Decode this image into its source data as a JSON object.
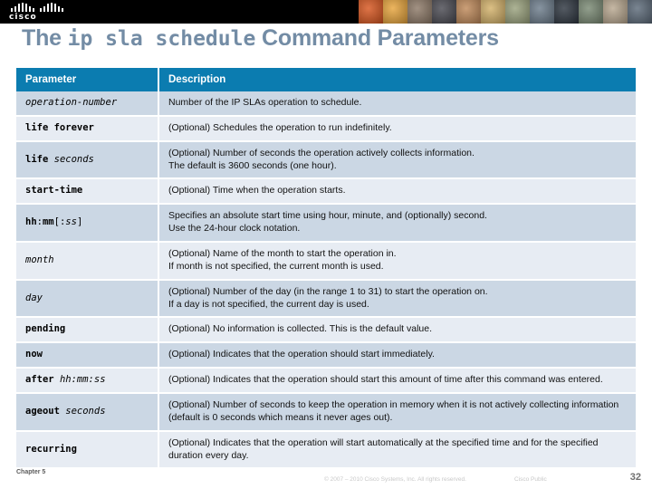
{
  "banner": {
    "logo_text": "cisco",
    "logo_name": "cisco-logo",
    "photo_strip_name": "people-photo-montage"
  },
  "slide": {
    "title_prefix": "The ",
    "title_command": "ip sla schedule",
    "title_suffix": " Command Parameters"
  },
  "table": {
    "headers": [
      "Parameter",
      "Description"
    ],
    "rows": [
      {
        "param_html": "<i>operation-number</i>",
        "param_text": "operation-number",
        "description": "Number of the IP SLAs operation to schedule."
      },
      {
        "param_html": "<b>life forever</b>",
        "param_text": "life forever",
        "description": "(Optional) Schedules the operation to run indefinitely."
      },
      {
        "param_html": "<b>life</b> <i>seconds</i>",
        "param_text": "life seconds",
        "description": "(Optional) Number of seconds the operation actively collects information.\nThe default is 3600 seconds (one hour)."
      },
      {
        "param_html": "<b>start-time</b>",
        "param_text": "start-time",
        "description": "(Optional) Time when the operation starts."
      },
      {
        "param_html": "<b>hh</b>:<b>mm</b>[:<i>ss</i>]",
        "param_text": "hh:mm[:ss]",
        "description": "Specifies an absolute start time using hour, minute, and (optionally) second.\nUse the 24-hour clock notation."
      },
      {
        "param_html": "<i>month</i>",
        "param_text": "month",
        "description": "(Optional) Name of the month to start the operation in.\nIf month is not specified, the current month is used."
      },
      {
        "param_html": "<i>day</i>",
        "param_text": "day",
        "description": "(Optional) Number of the day (in the range 1 to 31) to start the operation on.\nIf a day is not specified, the current day is used."
      },
      {
        "param_html": "<b>pending</b>",
        "param_text": "pending",
        "description": "(Optional) No information is collected. This is the default value."
      },
      {
        "param_html": "<b>now</b>",
        "param_text": "now",
        "description": "(Optional) Indicates that the operation should start immediately."
      },
      {
        "param_html": "<b>after</b> <i>hh:mm:ss</i>",
        "param_text": "after hh:mm:ss",
        "description": "(Optional) Indicates that the operation should start this amount of time after this command was entered."
      },
      {
        "param_html": "<b>ageout</b> <i>seconds</i>",
        "param_text": "ageout seconds",
        "description": "(Optional) Number of seconds to keep the operation in memory when it is not actively collecting information (default is 0 seconds which means it never ages out)."
      },
      {
        "param_html": "<b>recurring</b>",
        "param_text": "recurring",
        "description": "(Optional) Indicates that the operation will start automatically at the specified time and for the specified duration every day."
      }
    ]
  },
  "footer": {
    "chapter": "Chapter 5",
    "copyright": "© 2007 – 2010 Cisco Systems, Inc. All rights reserved.",
    "cisco_public": "Cisco Public",
    "page_number": "32"
  },
  "colors": {
    "banner_bg": "#000000",
    "header_blue": "#0b7cb0",
    "row_odd": "#cbd7e4",
    "row_even": "#e7ecf3",
    "title_color": "#738ca5"
  }
}
